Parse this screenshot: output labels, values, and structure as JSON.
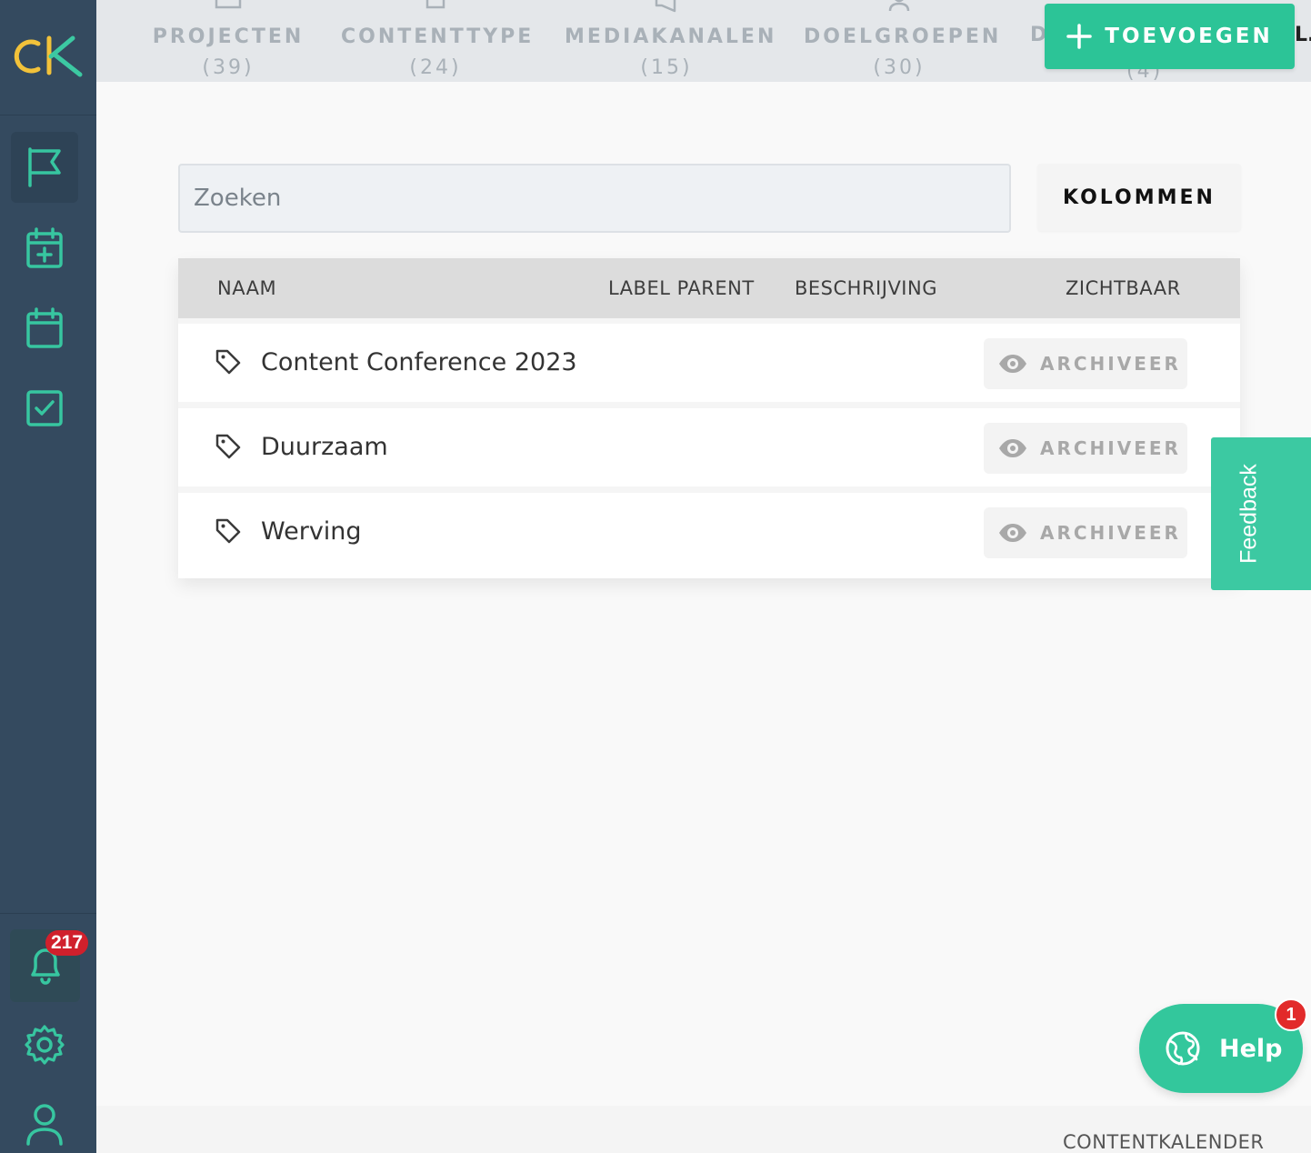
{
  "colors": {
    "sidebar": "#344a5f",
    "accent": "#2cc497",
    "icon": "#37c6a0",
    "badge": "#d0202c",
    "tab_text": "#a9b1b8"
  },
  "sidebar": {
    "logo": "CK",
    "items": [
      {
        "icon": "flag-icon",
        "active": true
      },
      {
        "icon": "calendar-plus-icon",
        "active": false
      },
      {
        "icon": "calendar-icon",
        "active": false
      },
      {
        "icon": "checkbox-icon",
        "active": false
      }
    ],
    "bottom": {
      "notifications_count": "217",
      "notifications_icon": "bell-icon",
      "settings_icon": "gear-icon",
      "profile_icon": "user-icon"
    }
  },
  "tabs": [
    {
      "label": "PROJECTEN",
      "count": "(39)",
      "icon": "folder-icon"
    },
    {
      "label": "CONTENTTYPE",
      "count": "(24)",
      "icon": "file-icon"
    },
    {
      "label": "MEDIAKANALEN",
      "count": "(15)",
      "icon": "megaphone-icon"
    },
    {
      "label": "DOELGROEPEN",
      "count": "(30)",
      "icon": "person-icon"
    }
  ],
  "tab_partial": {
    "label": "D",
    "count": "(4)",
    "right_edge": "L."
  },
  "toolbar": {
    "add_label": "TOEVOEGEN"
  },
  "search": {
    "placeholder": "Zoeken",
    "value": ""
  },
  "columns_button": "KOLOMMEN",
  "table": {
    "headers": [
      "NAAM",
      "LABEL PARENT",
      "BESCHRIJVING",
      "ZICHTBAAR"
    ],
    "rows": [
      {
        "name": "Content Conference 2023",
        "label_parent": "",
        "description": "",
        "action": "ARCHIVEER"
      },
      {
        "name": "Duurzaam",
        "label_parent": "",
        "description": "",
        "action": "ARCHIVEER"
      },
      {
        "name": "Werving",
        "label_parent": "",
        "description": "",
        "action": "ARCHIVEER"
      }
    ]
  },
  "feedback_label": "Feedback",
  "help": {
    "label": "Help",
    "badge": "1"
  },
  "footer": {
    "text": "CONTENTKALENDER"
  }
}
